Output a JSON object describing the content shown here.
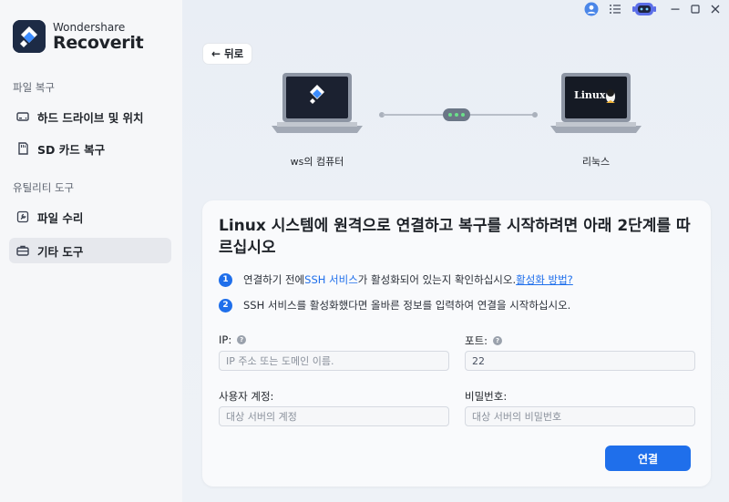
{
  "app": {
    "brand_line1": "Wondershare",
    "brand_line2": "Recoverit"
  },
  "sidebar": {
    "sections": [
      {
        "title": "파일 복구",
        "items": [
          {
            "label": "하드 드라이브 및 위치",
            "icon": "hard-drive-icon"
          },
          {
            "label": "SD 카드 복구",
            "icon": "sd-card-icon"
          }
        ]
      },
      {
        "title": "유틸리티 도구",
        "items": [
          {
            "label": "파일 수리",
            "icon": "wrench-icon"
          },
          {
            "label": "기타 도구",
            "icon": "toolbox-icon",
            "active": true
          }
        ]
      }
    ]
  },
  "topbar": {
    "icons": [
      "account-icon",
      "menu-icon",
      "assistant-bot-icon",
      "minimize-icon",
      "maximize-icon",
      "close-icon"
    ]
  },
  "main": {
    "back_label": "뒤로",
    "source_device_label": "ws의 컴퓨터",
    "target_device_label": "리눅스",
    "target_screen_text": "Linux",
    "card": {
      "title": "Linux 시스템에 원격으로 연결하고 복구를 시작하려면 아래 2단계를 따르십시오",
      "steps": [
        {
          "num": "1",
          "text_before": "연결하기 전에 ",
          "ssh_link": "SSH 서비스",
          "text_after": "가 활성화되어 있는지 확인하십시오. ",
          "how_link": "활성화 방법?"
        },
        {
          "num": "2",
          "text": "SSH 서비스를 활성화했다면 올바른 정보를 입력하여 연결을 시작하십시오."
        }
      ],
      "fields": {
        "ip": {
          "label": "IP:",
          "placeholder": "IP 주소 또는 도메인 이름.",
          "value": ""
        },
        "port": {
          "label": "포트:",
          "placeholder": "",
          "value": "22"
        },
        "username": {
          "label": "사용자 계정:",
          "placeholder": "대상 서버의 계정",
          "value": ""
        },
        "password": {
          "label": "비밀번호:",
          "placeholder": "대상 서버의 비밀번호",
          "value": ""
        }
      },
      "connect_label": "연결"
    }
  },
  "colors": {
    "accent": "#1f6feb",
    "sidebar_bg": "#f6f7f9",
    "active_item_bg": "#e6e8ed",
    "status_dot": "#6be08a"
  }
}
